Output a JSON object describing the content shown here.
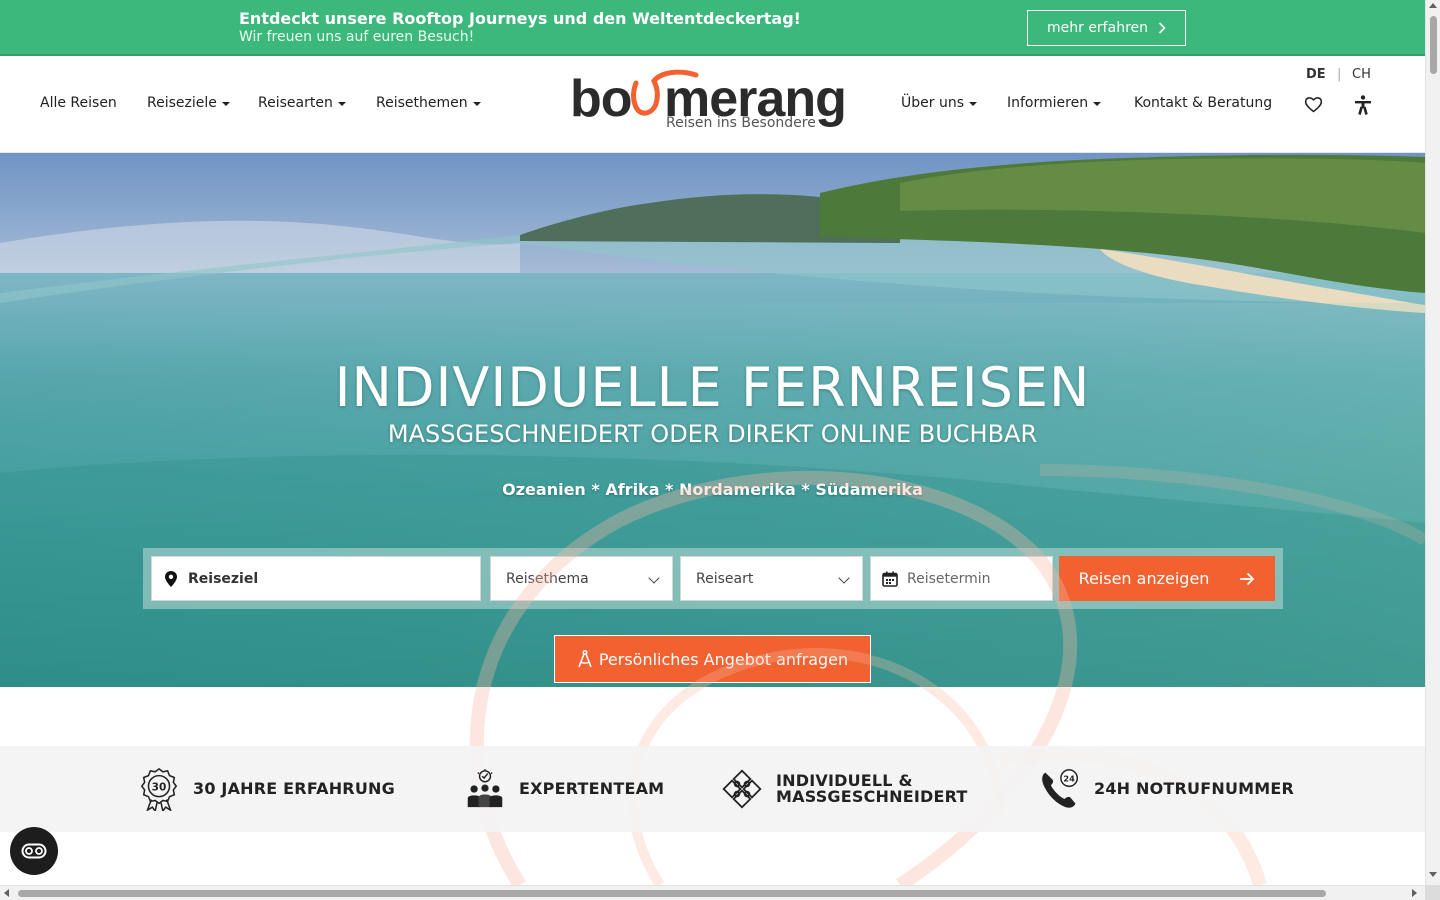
{
  "banner": {
    "title": "Entdeckt unsere Rooftop Journeys und den Weltentdeckertag!",
    "subtitle": "Wir freuen uns auf euren Besuch!",
    "button_label": "mehr erfahren",
    "button_icon": "chevron-right-icon",
    "color": "#3cb87c"
  },
  "nav_left": [
    {
      "label": "Alle Reisen",
      "dropdown": false
    },
    {
      "label": "Reiseziele",
      "dropdown": true
    },
    {
      "label": "Reisearten",
      "dropdown": true
    },
    {
      "label": "Reisethemen",
      "dropdown": true
    }
  ],
  "logo": {
    "wordmark": "boomerang",
    "tagline": "Reisen ins Besondere",
    "accent": "#f26130"
  },
  "nav_right": [
    {
      "label": "Über uns",
      "dropdown": true
    },
    {
      "label": "Informieren",
      "dropdown": true
    },
    {
      "label": "Kontakt & Beratung",
      "dropdown": false
    }
  ],
  "languages": {
    "active": "DE",
    "other": "CH",
    "separator": "|"
  },
  "header_icons": [
    "heart-icon",
    "accessibility-icon"
  ],
  "hero": {
    "title": "INDIVIDUELLE FERNREISEN",
    "subtitle": "MASSGESCHNEIDERT ODER DIREKT ONLINE BUCHBAR",
    "regions": "Ozeanien * Afrika * Nordamerika * Südamerika"
  },
  "search": {
    "destination_placeholder": "Reiseziel",
    "theme_placeholder": "Reisethema",
    "type_placeholder": "Reiseart",
    "date_placeholder": "Reisetermin",
    "submit_label": "Reisen anzeigen",
    "submit_color": "#f26130"
  },
  "offer_button": {
    "label": "Persönliches Angebot anfragen",
    "icon": "compass-drafting-icon"
  },
  "features": [
    {
      "icon": "award-30-icon",
      "label": "30 JAHRE ERFAHRUNG"
    },
    {
      "icon": "expert-team-icon",
      "label": "EXPERTENTEAM"
    },
    {
      "icon": "puzzle-icon",
      "label_line1": "INDIVIDUELL &",
      "label_line2": "MASSGESCHNEIDERT"
    },
    {
      "icon": "phone-24-icon",
      "label": "24H NOTRUFNUMMER"
    }
  ],
  "a11y_button_icon": "accessibility-toggle-icon"
}
